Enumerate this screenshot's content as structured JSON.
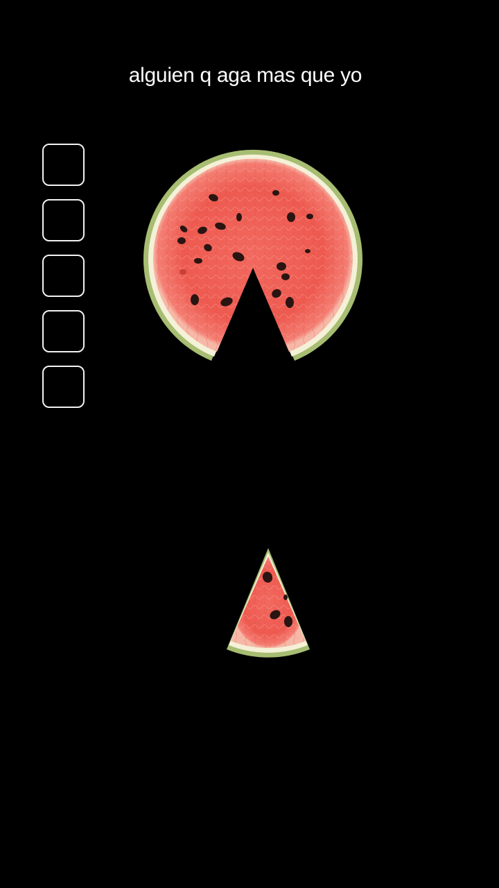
{
  "caption": "alguien q aga mas que yo",
  "slots": [
    {
      "filled": false
    },
    {
      "filled": false
    },
    {
      "filled": false
    },
    {
      "filled": false
    },
    {
      "filled": false
    }
  ],
  "colors": {
    "background": "#000000",
    "flesh": "#ef5a50",
    "flesh_light": "#f58f86",
    "rind_inner": "#f4f1d8",
    "rind_outer": "#a7bd72",
    "seed": "#2a1512",
    "slot_border": "#f2f2f2"
  }
}
